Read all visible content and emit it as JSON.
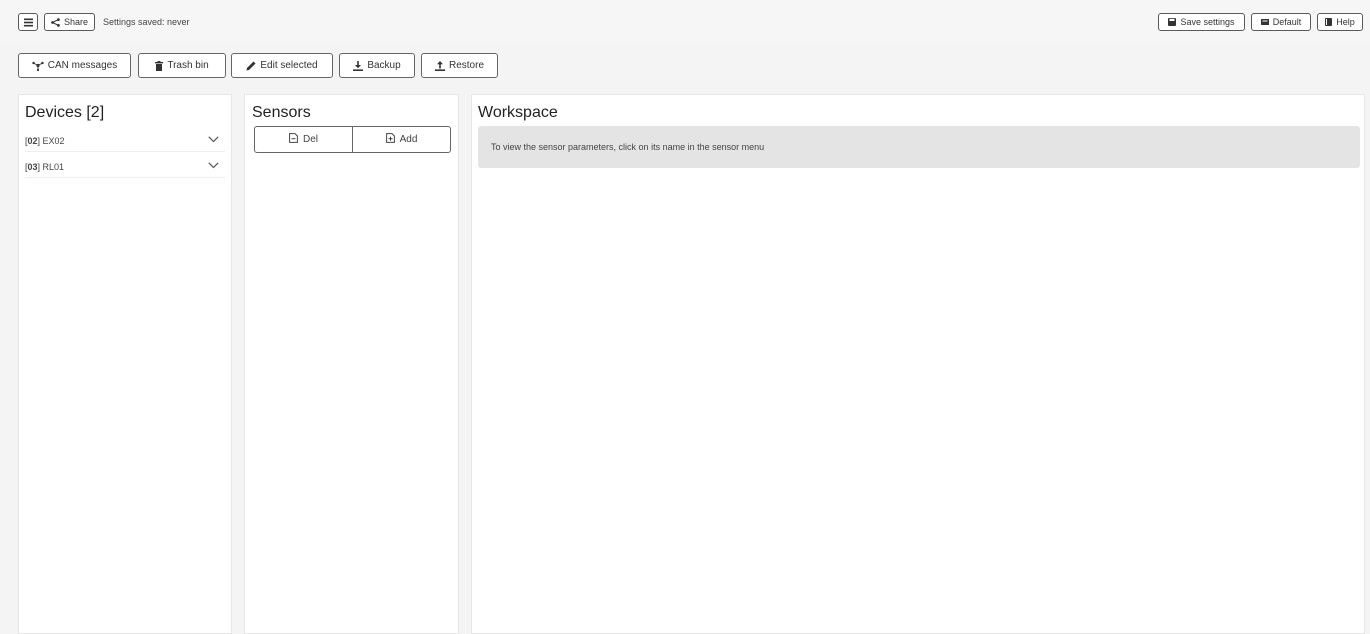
{
  "header": {
    "menu_icon": "list-icon",
    "share": {
      "label": "Share",
      "icon": "share-icon"
    },
    "status": "Settings saved: never",
    "save_settings": {
      "label": "Save settings",
      "icon": "floppy-icon"
    },
    "default": {
      "label": "Default",
      "icon": "reset-icon"
    },
    "help": {
      "label": "Help",
      "icon": "book-icon"
    }
  },
  "toolbar": {
    "can_messages": {
      "label": "CAN messages",
      "icon": "network-icon"
    },
    "trash_bin": {
      "label": "Trash bin",
      "icon": "trash-icon"
    },
    "edit_selected": {
      "label": "Edit selected",
      "icon": "pencil-icon"
    },
    "backup": {
      "label": "Backup",
      "icon": "download-icon"
    },
    "restore": {
      "label": "Restore",
      "icon": "upload-icon"
    }
  },
  "devices": {
    "title": "Devices [2]",
    "items": [
      {
        "id": "02",
        "name": "EX02"
      },
      {
        "id": "03",
        "name": "RL01"
      }
    ]
  },
  "sensors": {
    "title": "Sensors",
    "del_label": "Del",
    "add_label": "Add"
  },
  "workspace": {
    "title": "Workspace",
    "hint": "To view the sensor parameters, click on its name in the sensor menu"
  },
  "colors": {
    "background": "#f4f4f4",
    "panel": "#ffffff",
    "hint_bg": "#e4e4e4",
    "border": "#5a5a5a"
  }
}
